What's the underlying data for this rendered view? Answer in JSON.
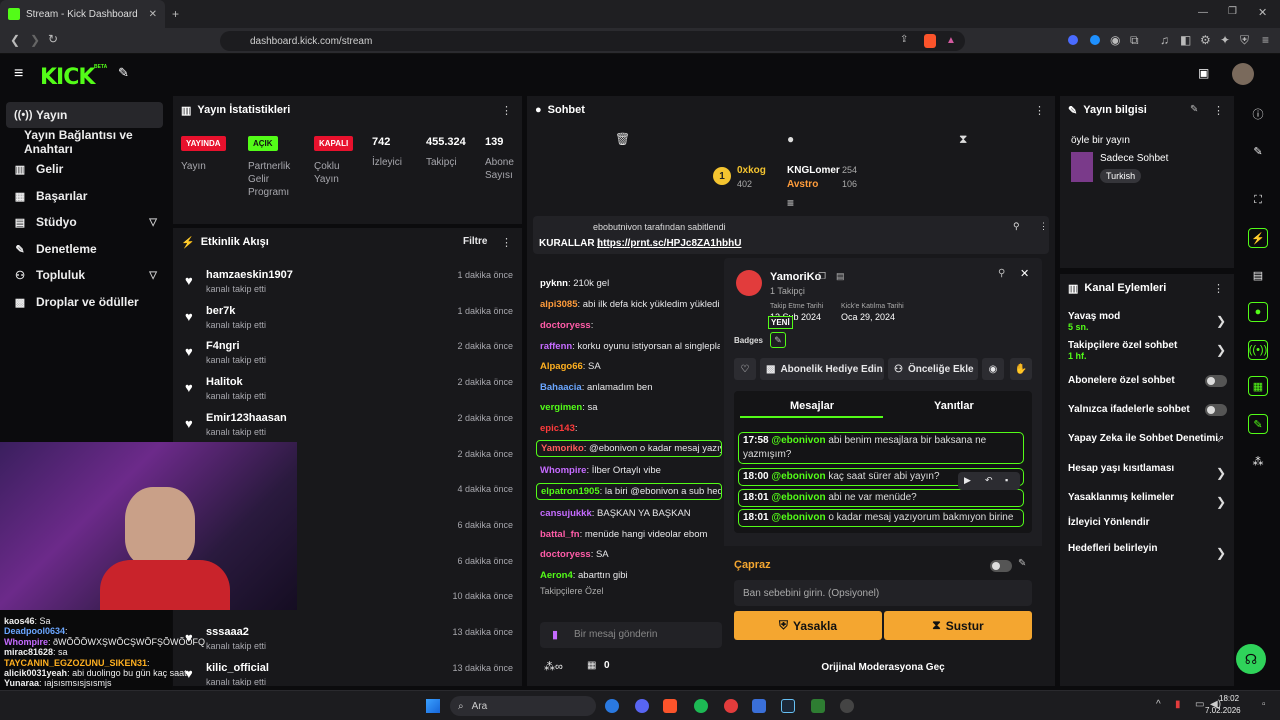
{
  "browser": {
    "tab_title": "Stream - Kick Dashboard",
    "url": "dashboard.kick.com/stream"
  },
  "brand": {
    "logo": "KICK",
    "logo_badge": "BETA",
    "accent": "#53fc18"
  },
  "sidebar": {
    "items": [
      {
        "label": "Yayın",
        "icon": "broadcast-icon"
      },
      {
        "label": "Yayın Bağlantısı ve Anahtarı",
        "icon": ""
      },
      {
        "label": "Gelir",
        "icon": "chart-icon"
      },
      {
        "label": "Başarılar",
        "icon": "trophy-icon"
      },
      {
        "label": "Stüdyo",
        "icon": "film-icon"
      },
      {
        "label": "Denetleme",
        "icon": "wrench-icon"
      },
      {
        "label": "Topluluk",
        "icon": "people-icon"
      },
      {
        "label": "Droplar ve ödüller",
        "icon": "gift-icon"
      }
    ]
  },
  "stats": {
    "title": "Yayın İstatistikleri",
    "tags": [
      {
        "tag": "YAYINDA",
        "label": "Yayın"
      },
      {
        "tag": "AÇIK",
        "label": "Partnerlik Gelir Programı"
      },
      {
        "tag": "KAPALI",
        "label": "Çoklu Yayın"
      }
    ],
    "numbers": [
      {
        "value": "742",
        "label": "İzleyici"
      },
      {
        "value": "455.324",
        "label": "Takipçi"
      },
      {
        "value": "139",
        "label": "Abone Sayısı"
      }
    ]
  },
  "activity": {
    "title": "Etkinlik Akışı",
    "filter": "Filtre",
    "items": [
      {
        "name": "hamzaeskin1907",
        "sub": "kanalı takip etti",
        "time": "1 dakika önce"
      },
      {
        "name": "ber7k",
        "sub": "kanalı takip etti",
        "time": "1 dakika önce"
      },
      {
        "name": "F4ngri",
        "sub": "kanalı takip etti",
        "time": "2 dakika önce"
      },
      {
        "name": "Halitok",
        "sub": "kanalı takip etti",
        "time": "2 dakika önce"
      },
      {
        "name": "Emir123haasan",
        "sub": "kanalı takip etti",
        "time": "2 dakika önce"
      },
      {
        "name": "",
        "sub": "",
        "time": "2 dakika önce"
      },
      {
        "name": "",
        "sub": "",
        "time": "4 dakika önce"
      },
      {
        "name": "",
        "sub": "",
        "time": "6 dakika önce"
      },
      {
        "name": "",
        "sub": "",
        "time": "6 dakika önce"
      },
      {
        "name": "",
        "sub": "",
        "time": "10 dakika önce"
      },
      {
        "name": "sssaaa2",
        "sub": "kanalı takip etti",
        "time": "13 dakika önce"
      },
      {
        "name": "kilic_official",
        "sub": "kanalı takip etti",
        "time": "13 dakika önce"
      }
    ]
  },
  "overlay_chat": [
    {
      "user": "kaos46",
      "text": ": Sa",
      "color": "#eee"
    },
    {
      "user": "Deadpool0634",
      "text": ":",
      "color": "#6aa6ff"
    },
    {
      "user": "Whompire",
      "text": ": ðWÕÕÕWXŞWÕCŞWÕFŞÕWÕÕFQ",
      "color": "#c56bff"
    },
    {
      "user": "mirac81628",
      "text": ": sa",
      "color": "#eee"
    },
    {
      "user": "TAYCANIN_EGZOZUNU_SIKEN31",
      "text": ":",
      "color": "#ffb020"
    },
    {
      "user": "alicik0031yeah",
      "text": ": abi duolingo bu gün kaç saat",
      "color": "#eee"
    },
    {
      "user": "Yunaraa",
      "text": ": ıajsısmsısjsısmjs",
      "color": "#eee"
    }
  ],
  "chat": {
    "title": "Sohbet",
    "top_gifters": [
      {
        "rank": "1",
        "name": "0xkog",
        "count": "402"
      },
      {
        "name": "KNGLomer",
        "count": "254"
      },
      {
        "name": "Avstro",
        "count": "106"
      }
    ],
    "pinned_by": "ebobutnivon tarafından sabitlendi",
    "pinned_text": "KURALLAR | ",
    "pinned_link": "https://prnt.sc/HPJc8ZA1hbhU",
    "messages": [
      {
        "user": "pyknn",
        "text": ": 210k gel",
        "color": "#fff"
      },
      {
        "user": "alpi3085",
        "text": ": abi ilk defa kick yükledim yükledim",
        "color": "#ff9c3b"
      },
      {
        "user": "doctoryess",
        "text": ":",
        "color": "#ff5ca8"
      },
      {
        "user": "raffenn",
        "text": ": korku oyunu istiyorsan al singleplayer",
        "color": "#c56bff"
      },
      {
        "user": "Alpago66",
        "text": ": SA",
        "color": "#ffb020"
      },
      {
        "user": "Bahaacia",
        "text": ": anlamadım ben",
        "color": "#6aa6ff"
      },
      {
        "user": "vergimen",
        "text": ": sa",
        "color": "#53fc18"
      },
      {
        "user": "epic143",
        "text": ":",
        "color": "#ff3b3b"
      },
      {
        "user": "Yamoriko",
        "text": ": @ebonivon o kadar mesaj yazıyorum",
        "color": "#ff5c5c"
      },
      {
        "user": "Whompire",
        "text": ": İlber Ortaylı vibe",
        "color": "#c56bff"
      },
      {
        "user": "elpatron1905",
        "text": ": la biri @ebonivon a sub hediye",
        "color": "#53fc18"
      },
      {
        "user": "cansujukkk",
        "text": ": BAŞKAN YA BAŞKAN",
        "color": "#c56bff"
      },
      {
        "user": "battal_fn",
        "text": ": menüde hangi videolar ebom",
        "color": "#ff5ca8"
      },
      {
        "user": "doctoryess",
        "text": ": SA",
        "color": "#ff5ca8"
      },
      {
        "user": "Aeron4",
        "text": ": abarttın gibi",
        "color": "#53fc18"
      }
    ],
    "followers_only": "Takipçilere Özel",
    "input_placeholder": "Bir mesaj gönderin",
    "points": "0"
  },
  "usercard": {
    "name": "YamoriKo",
    "followers": "1 Takipçi",
    "follow_date_label": "Takip Etme Tarihi",
    "follow_date": "12 Şub 2024",
    "join_label": "Kick'e Katılma Tarihi",
    "join_date": "Oca 29, 2024",
    "badge_new": "YENİ",
    "badges_label": "Badges",
    "gift_button": "Abonelik Hediye Edin",
    "priority_button": "Önceliğe Ekle",
    "tabs": [
      "Mesajlar",
      "Yanıtlar"
    ],
    "messages": [
      {
        "time": "17:58",
        "mention": "@ebonivon",
        "text": "abi benim mesajlara bir baksana ne yazmışım?"
      },
      {
        "time": "18:00",
        "mention": "@ebonivon",
        "text": "kaç saat sürer abi yayın?"
      },
      {
        "time": "18:01",
        "mention": "@ebonivon",
        "text": "abi ne var menüde?"
      },
      {
        "time": "18:01",
        "mention": "@ebonivon",
        "text": "o kadar mesaj yazıyorum bakmıyon birine"
      }
    ],
    "cross_label": "Çapraz",
    "ban_placeholder": "Ban sebebini girin. (Opsiyonel)",
    "ban_button": "Yasakla",
    "mute_button": "Sustur",
    "mod_link": "Orijinal Moderasyona Geç"
  },
  "stream_info": {
    "title": "Yayın bilgisi",
    "stream_title": "öyle bir yayın",
    "category": "Sadece Sohbet",
    "language": "Turkish"
  },
  "channel_actions": {
    "title": "Kanal Eylemleri",
    "items": [
      {
        "label": "Yavaş mod",
        "sub": "5 sn."
      },
      {
        "label": "Takipçilere özel sohbet",
        "sub": "1 hf."
      },
      {
        "label": "Abonelere özel sohbet",
        "sub": ""
      },
      {
        "label": "Yalnızca ifadelerle sohbet",
        "sub": ""
      },
      {
        "label": "Yapay Zeka ile Sohbet Denetimi",
        "sub": ""
      },
      {
        "label": "Hesap yaşı kısıtlaması",
        "sub": ""
      },
      {
        "label": "Yasaklanmış kelimeler",
        "sub": ""
      },
      {
        "label": "İzleyici Yönlendir",
        "sub": ""
      },
      {
        "label": "Hedefleri belirleyin",
        "sub": ""
      }
    ]
  },
  "taskbar": {
    "search": "Ara",
    "time": "18:02",
    "date": "7.02.2026"
  }
}
